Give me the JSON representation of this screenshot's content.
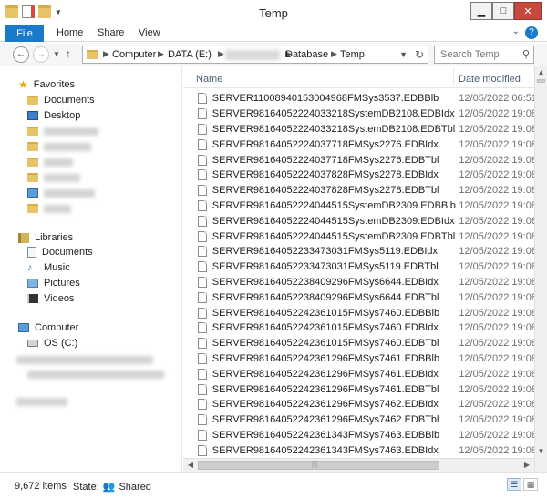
{
  "window": {
    "title": "Temp"
  },
  "ribbon": {
    "tabs": [
      "File",
      "Home",
      "Share",
      "View"
    ],
    "help": "?"
  },
  "address": {
    "segments": [
      "Computer",
      "DATA (E:)",
      "Database",
      "Temp"
    ],
    "search_placeholder": "Search Temp"
  },
  "nav": {
    "favorites_label": "Favorites",
    "favorites": [
      "Documents",
      "Desktop"
    ],
    "libraries_label": "Libraries",
    "libraries": [
      "Documents",
      "Music",
      "Pictures",
      "Videos"
    ],
    "computer_label": "Computer",
    "drives": [
      "OS (C:)"
    ]
  },
  "columns": {
    "name": "Name",
    "date": "Date modified"
  },
  "files": [
    {
      "name": "SERVER11008940153004968FMSys3537.EDBBlb",
      "date": "12/05/2022 06:51"
    },
    {
      "name": "SERVER98164052224033218SystemDB2108.EDBIdx",
      "date": "12/05/2022 19:08"
    },
    {
      "name": "SERVER98164052224033218SystemDB2108.EDBTbl",
      "date": "12/05/2022 19:08"
    },
    {
      "name": "SERVER98164052224037718FMSys2276.EDBIdx",
      "date": "12/05/2022 19:08"
    },
    {
      "name": "SERVER98164052224037718FMSys2276.EDBTbl",
      "date": "12/05/2022 19:08"
    },
    {
      "name": "SERVER98164052224037828FMSys2278.EDBIdx",
      "date": "12/05/2022 19:08"
    },
    {
      "name": "SERVER98164052224037828FMSys2278.EDBTbl",
      "date": "12/05/2022 19:08"
    },
    {
      "name": "SERVER98164052224044515SystemDB2309.EDBBlb",
      "date": "12/05/2022 19:08"
    },
    {
      "name": "SERVER98164052224044515SystemDB2309.EDBIdx",
      "date": "12/05/2022 19:08"
    },
    {
      "name": "SERVER98164052224044515SystemDB2309.EDBTbl",
      "date": "12/05/2022 19:08"
    },
    {
      "name": "SERVER98164052233473031FMSys5119.EDBIdx",
      "date": "12/05/2022 19:08"
    },
    {
      "name": "SERVER98164052233473031FMSys5119.EDBTbl",
      "date": "12/05/2022 19:08"
    },
    {
      "name": "SERVER98164052238409296FMSys6644.EDBIdx",
      "date": "12/05/2022 19:08"
    },
    {
      "name": "SERVER98164052238409296FMSys6644.EDBTbl",
      "date": "12/05/2022 19:08"
    },
    {
      "name": "SERVER98164052242361015FMSys7460.EDBBlb",
      "date": "12/05/2022 19:08"
    },
    {
      "name": "SERVER98164052242361015FMSys7460.EDBIdx",
      "date": "12/05/2022 19:08"
    },
    {
      "name": "SERVER98164052242361015FMSys7460.EDBTbl",
      "date": "12/05/2022 19:08"
    },
    {
      "name": "SERVER98164052242361296FMSys7461.EDBBlb",
      "date": "12/05/2022 19:08"
    },
    {
      "name": "SERVER98164052242361296FMSys7461.EDBIdx",
      "date": "12/05/2022 19:08"
    },
    {
      "name": "SERVER98164052242361296FMSys7461.EDBTbl",
      "date": "12/05/2022 19:08"
    },
    {
      "name": "SERVER98164052242361296FMSys7462.EDBIdx",
      "date": "12/05/2022 19:08"
    },
    {
      "name": "SERVER98164052242361296FMSys7462.EDBTbl",
      "date": "12/05/2022 19:08"
    },
    {
      "name": "SERVER98164052242361343FMSys7463.EDBBlb",
      "date": "12/05/2022 19:08"
    },
    {
      "name": "SERVER98164052242361343FMSys7463.EDBIdx",
      "date": "12/05/2022 19:08"
    }
  ],
  "status": {
    "count": "9,672 items",
    "state_label": "State:",
    "state_value": "Shared"
  },
  "colors": {
    "accent": "#1979ca",
    "folder": "#e8c468",
    "close": "#c7483d"
  }
}
